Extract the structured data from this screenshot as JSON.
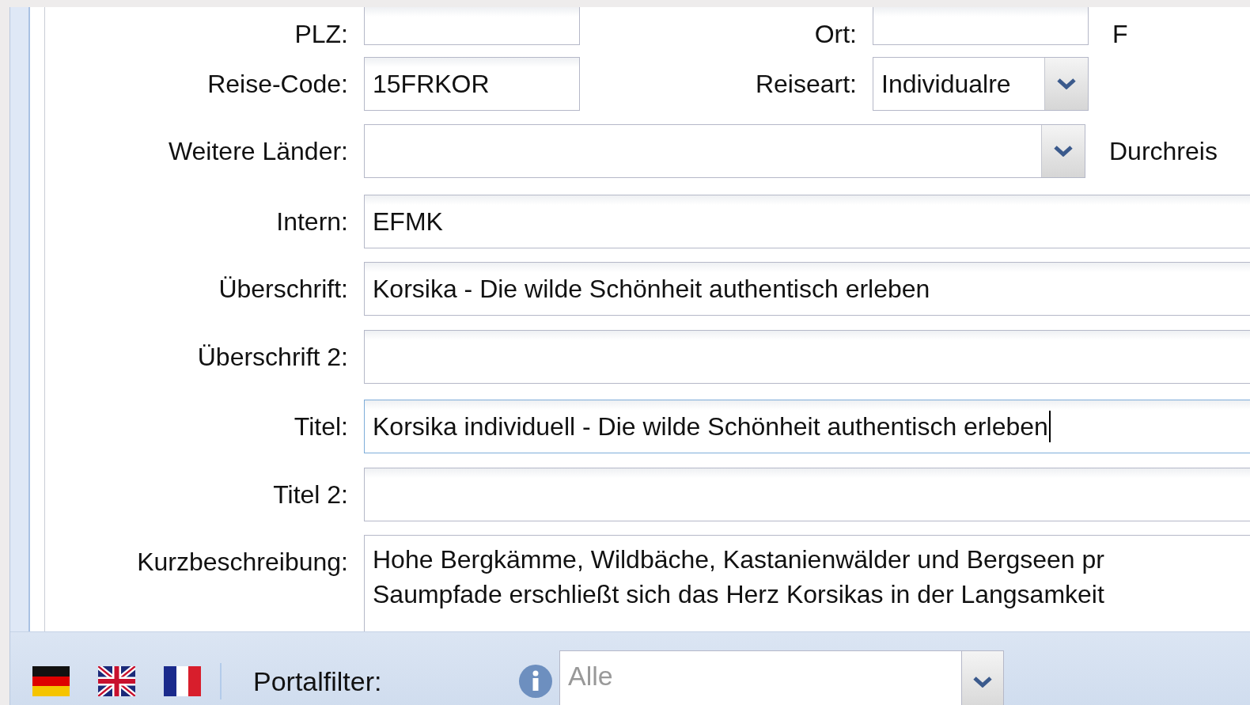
{
  "form": {
    "rows": [
      {
        "fields": [
          {
            "label": "PLZ:",
            "kind": "text"
          },
          {
            "label": "Ort:",
            "kind": "text"
          },
          {
            "label": "F",
            "kind": "label_only"
          }
        ]
      },
      {
        "fields": [
          {
            "label": "Reise-Code:",
            "kind": "text",
            "value": "15FRKOR"
          },
          {
            "label": "Reiseart:",
            "kind": "select",
            "value": "Individualre"
          }
        ]
      },
      {
        "fields": [
          {
            "label": "Weitere Länder:",
            "kind": "select"
          },
          {
            "label": "Durchreis",
            "kind": "label_only"
          }
        ]
      },
      {
        "fields": [
          {
            "label": "Intern:",
            "kind": "text",
            "value": "EFMK"
          }
        ]
      },
      {
        "fields": [
          {
            "label": "Überschrift:",
            "kind": "text",
            "value": "Korsika - Die wilde Schönheit authentisch erleben"
          }
        ]
      },
      {
        "fields": [
          {
            "label": "Überschrift 2:",
            "kind": "text"
          }
        ]
      },
      {
        "fields": [
          {
            "label": "Titel:",
            "kind": "text",
            "value": "Korsika individuell - Die wilde Schönheit authentisch erleben",
            "focused": true
          }
        ]
      },
      {
        "fields": [
          {
            "label": "Titel 2:",
            "kind": "text"
          }
        ]
      },
      {
        "fields": [
          {
            "label": "Kurzbeschreibung:",
            "kind": "textarea",
            "lines": [
              "Hohe Bergkämme, Wildbäche, Kastanienwälder und Bergseen pr",
              "Saumpfade erschließt sich das Herz Korsikas in der Langsamkeit"
            ]
          }
        ]
      }
    ]
  },
  "footer": {
    "languages": [
      {
        "kind": "de"
      },
      {
        "kind": "en"
      },
      {
        "kind": "fr"
      }
    ],
    "portal_filter": {
      "label": "Portalfilter:",
      "placeholder": "Alle"
    }
  }
}
